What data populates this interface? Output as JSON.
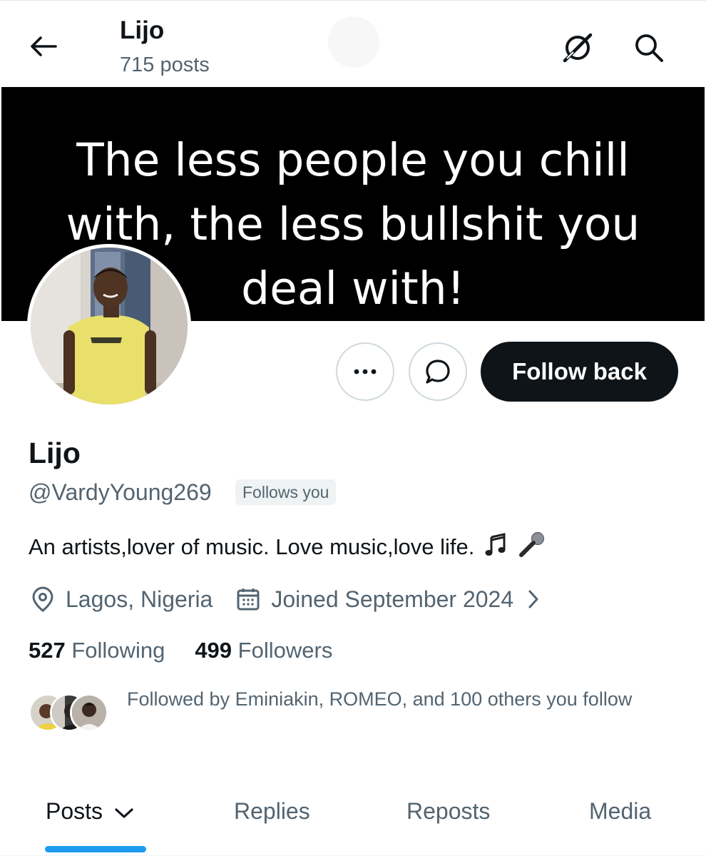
{
  "header": {
    "title": "Lijo",
    "post_count": "715 posts"
  },
  "banner": {
    "lines": [
      "The less people you chill",
      "with, the less bullshit you",
      "deal with!"
    ]
  },
  "actions": {
    "follow_label": "Follow back"
  },
  "profile": {
    "name": "Lijo",
    "handle": "@VardyYoung269",
    "follows_badge": "Follows you",
    "bio": "An artists,lover of music. Love music,love life.",
    "location": "Lagos, Nigeria",
    "joined": "Joined September 2024",
    "following_count": "527",
    "following_label": "Following",
    "followers_count": "499",
    "followers_label": "Followers",
    "followed_by": "Followed by Eminiakin, ROMEO, and 100 others you follow"
  },
  "tabs": [
    {
      "label": "Posts",
      "active": true
    },
    {
      "label": "Replies",
      "active": false
    },
    {
      "label": "Reposts",
      "active": false
    },
    {
      "label": "Media",
      "active": false
    }
  ],
  "icons": {
    "back": "arrow-left-icon",
    "grok": "grok-icon",
    "search": "search-icon",
    "more": "more-horizontal-icon",
    "message": "message-bubble-icon",
    "location": "location-pin-icon",
    "calendar": "calendar-icon",
    "chevron": "chevron-right-icon",
    "music": "music-note-icon",
    "mic": "microphone-icon"
  },
  "colors": {
    "accent": "#1d9bf0",
    "text_primary": "#0f1419",
    "text_secondary": "#536471",
    "button_dark": "#0f1419",
    "banner_bg": "#000000"
  }
}
